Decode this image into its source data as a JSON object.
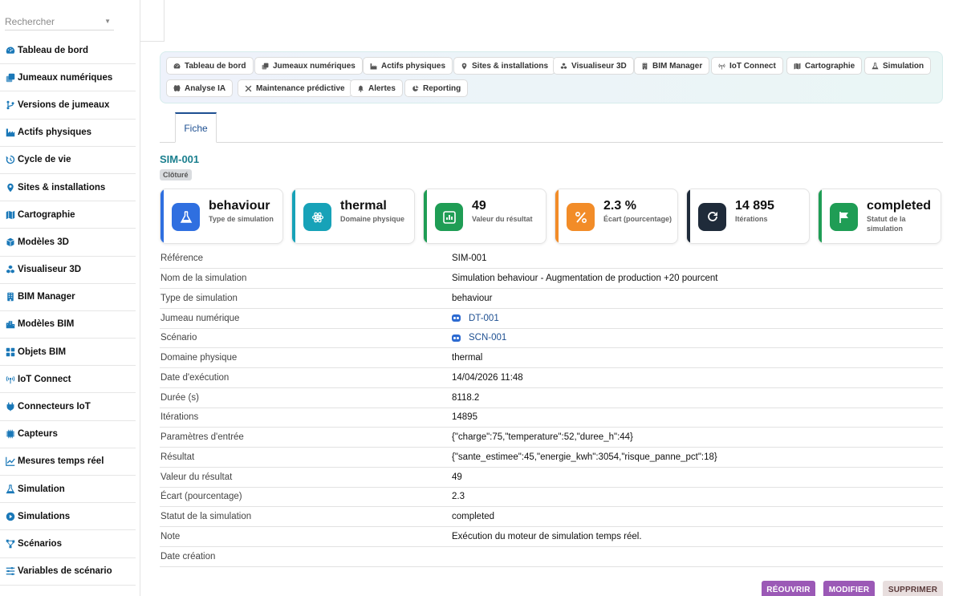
{
  "sidebar": {
    "search_placeholder": "Rechercher",
    "items": [
      {
        "label": "Tableau de bord",
        "icon": "gauge-icon"
      },
      {
        "label": "Jumeaux numériques",
        "icon": "copy-icon"
      },
      {
        "label": "Versions de jumeaux",
        "icon": "branch-icon"
      },
      {
        "label": "Actifs physiques",
        "icon": "industry-icon"
      },
      {
        "label": "Cycle de vie",
        "icon": "history-icon"
      },
      {
        "label": "Sites & installations",
        "icon": "location-pin-icon"
      },
      {
        "label": "Cartographie",
        "icon": "map-icon"
      },
      {
        "label": "Modèles 3D",
        "icon": "cube-icon"
      },
      {
        "label": "Visualiseur 3D",
        "icon": "cubes-icon"
      },
      {
        "label": "BIM Manager",
        "icon": "building-icon"
      },
      {
        "label": "Modèles BIM",
        "icon": "city-icon"
      },
      {
        "label": "Objets BIM",
        "icon": "grid-icon"
      },
      {
        "label": "IoT Connect",
        "icon": "antenna-icon"
      },
      {
        "label": "Connecteurs IoT",
        "icon": "plug-icon"
      },
      {
        "label": "Capteurs",
        "icon": "microchip-icon"
      },
      {
        "label": "Mesures temps réel",
        "icon": "line-chart-icon"
      },
      {
        "label": "Simulation",
        "icon": "flask-icon"
      },
      {
        "label": "Simulations",
        "icon": "play-circle-icon"
      },
      {
        "label": "Scénarios",
        "icon": "nodes-icon"
      },
      {
        "label": "Variables de scénario",
        "icon": "sliders-icon"
      }
    ]
  },
  "modules": [
    {
      "label": "Tableau de bord",
      "icon": "gauge-icon"
    },
    {
      "label": "Jumeaux numériques",
      "icon": "copy-icon"
    },
    {
      "label": "Actifs physiques",
      "icon": "industry-icon"
    },
    {
      "label": "Sites & installations",
      "icon": "location-pin-icon"
    },
    {
      "label": "Visualiseur 3D",
      "icon": "cubes-icon"
    },
    {
      "label": "BIM Manager",
      "icon": "building-icon"
    },
    {
      "label": "IoT Connect",
      "icon": "antenna-icon"
    },
    {
      "label": "Cartographie",
      "icon": "map-icon"
    },
    {
      "label": "Simulation",
      "icon": "flask-icon"
    },
    {
      "label": "Analyse IA",
      "icon": "brain-icon"
    },
    {
      "label": "Maintenance prédictive",
      "icon": "tools-icon"
    },
    {
      "label": "Alertes",
      "icon": "bell-icon"
    },
    {
      "label": "Reporting",
      "icon": "pie-chart-icon"
    }
  ],
  "tabs": {
    "fiche": "Fiche"
  },
  "record": {
    "title": "SIM-001",
    "status_badge": "Clôturé"
  },
  "kpis": [
    {
      "value": "behaviour",
      "label": "Type de simulation",
      "color": "#2f6fe0",
      "icon": "flask-icon"
    },
    {
      "value": "thermal",
      "label": "Domaine physique",
      "color": "#17a2b8",
      "icon": "atom-icon"
    },
    {
      "value": "49",
      "label": "Valeur du résultat",
      "color": "#1f9d55",
      "icon": "bar-chart-icon"
    },
    {
      "value": "2.3 %",
      "label": "Écart (pourcentage)",
      "color": "#f28c28",
      "icon": "percent-icon"
    },
    {
      "value": "14 895",
      "label": "Itérations",
      "color": "#1f2b3a",
      "icon": "redo-icon"
    },
    {
      "value": "completed",
      "label": "Statut de la simulation",
      "color": "#1f9d55",
      "icon": "flag-icon"
    }
  ],
  "details": [
    {
      "key": "Référence",
      "value": "SIM-001"
    },
    {
      "key": "Nom de la simulation",
      "value": "Simulation behaviour - Augmentation de production +20 pourcent"
    },
    {
      "key": "Type de simulation",
      "value": "behaviour"
    },
    {
      "key": "Jumeau numérique",
      "value": "DT-001",
      "link": true
    },
    {
      "key": "Scénario",
      "value": "SCN-001",
      "link": true
    },
    {
      "key": "Domaine physique",
      "value": "thermal"
    },
    {
      "key": "Date d'exécution",
      "value": "14/04/2026 11:48"
    },
    {
      "key": "Durée (s)",
      "value": "8118.2"
    },
    {
      "key": "Itérations",
      "value": "14895"
    },
    {
      "key": "Paramètres d'entrée",
      "value": "{\"charge\":75,\"temperature\":52,\"duree_h\":44}"
    },
    {
      "key": "Résultat",
      "value": "{\"sante_estimee\":45,\"energie_kwh\":3054,\"risque_panne_pct\":18}"
    },
    {
      "key": "Valeur du résultat",
      "value": "49"
    },
    {
      "key": "Écart (pourcentage)",
      "value": "2.3"
    },
    {
      "key": "Statut de la simulation",
      "value": "completed"
    },
    {
      "key": "Note",
      "value": "Exécution du moteur de simulation temps réel."
    },
    {
      "key": "Date création",
      "value": ""
    }
  ],
  "actions": {
    "reopen": "RÉOUVRIR",
    "edit": "MODIFIER",
    "delete": "SUPPRIMER",
    "reopen_color": "#9b59b6",
    "edit_color": "#9b59b6",
    "delete_color": "#e8dede"
  }
}
